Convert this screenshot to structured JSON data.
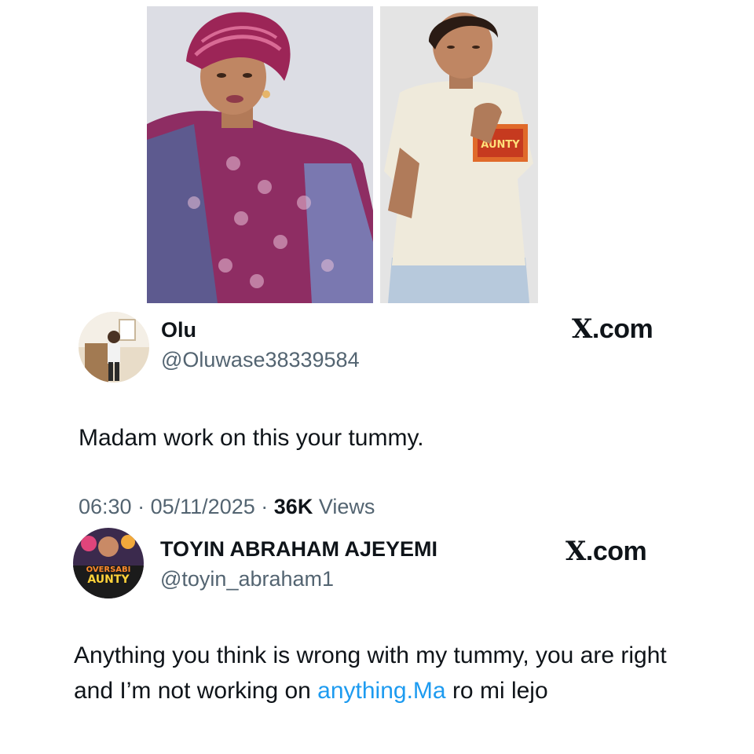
{
  "tweet1": {
    "name": "Olu",
    "handle": "@Oluwase38339584",
    "brand_x": "X",
    "brand_domain": ".com",
    "text": "Madam work on this your tummy.",
    "time": "06:30",
    "sep1": "·",
    "date": "05/11/2025",
    "sep2": "·",
    "views_count": "36K",
    "views_label": "Views"
  },
  "tweet2": {
    "name": "TOYIN ABRAHAM AJEYEMI",
    "handle": "@toyin_abraham1",
    "brand_x": "X",
    "brand_domain": ".com",
    "avatar_text_line1": "OVERSABI",
    "avatar_text_line2": "AUNTY",
    "text_before_link": "Anything you think is wrong with my tummy, you are right and I’m not working on ",
    "link_text": "anything.Ma",
    "text_after_link": " ro mi lejo"
  },
  "photos": {
    "shirt_text": "AUNTY"
  },
  "colors": {
    "link": "#1d9bf0",
    "secondary_text": "#536471",
    "primary_text": "#0f1419"
  }
}
